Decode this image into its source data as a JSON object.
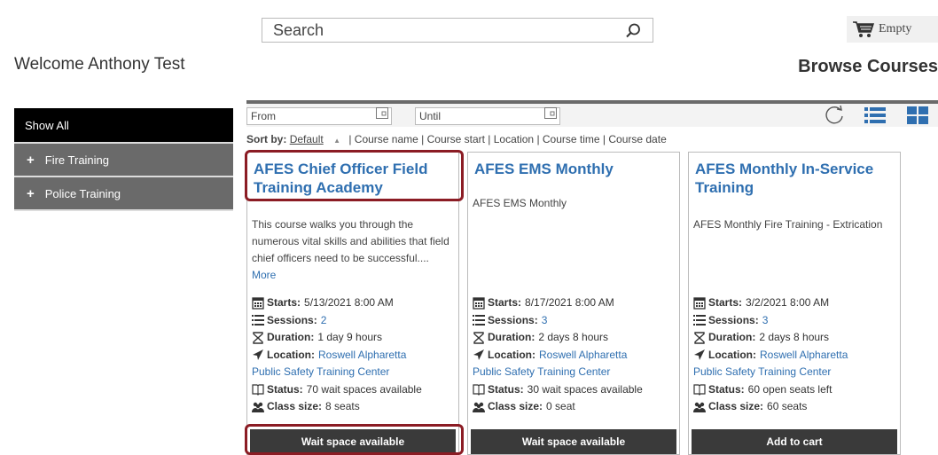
{
  "header": {
    "search_placeholder": "Search",
    "cart_label": "Empty",
    "welcome": "Welcome Anthony Test",
    "page_title": "Browse Courses"
  },
  "sidebar": {
    "items": [
      {
        "label": "Show All",
        "active": true
      },
      {
        "label": "Fire Training",
        "prefix": "+"
      },
      {
        "label": "Police Training",
        "prefix": "+"
      }
    ]
  },
  "filters": {
    "from_placeholder": "From",
    "until_placeholder": "Until"
  },
  "sort": {
    "label": "Sort by:",
    "default": "Default",
    "arrow": "▲",
    "options_text": "| Course name | Course start | Location | Course time | Course date"
  },
  "labels": {
    "starts": "Starts:",
    "sessions": "Sessions:",
    "duration": "Duration:",
    "location": "Location:",
    "status": "Status:",
    "class_size": "Class size:"
  },
  "courses": [
    {
      "title": "AFES Chief Officer Field Training Academy",
      "description": "This course walks you through the numerous vital skills and abilities that field chief officers need to be successful....",
      "more": "More",
      "starts": "5/13/2021 8:00 AM",
      "sessions": "2",
      "duration": "1 day 9 hours",
      "location_line1": "Roswell Alpharetta",
      "location_line2": "Public Safety Training Center",
      "status": "70 wait spaces available",
      "class_size": "8 seats",
      "button": "Wait space available"
    },
    {
      "title": "AFES EMS Monthly",
      "description": "AFES EMS Monthly",
      "starts": "8/17/2021 8:00 AM",
      "sessions": "3",
      "duration": "2 days 8 hours",
      "location_line1": "Roswell Alpharetta",
      "location_line2": "Public Safety Training Center",
      "status": "30 wait spaces available",
      "class_size": "0 seat",
      "button": "Wait space available"
    },
    {
      "title": "AFES Monthly In-Service Training",
      "description": "AFES Monthly Fire Training - Extrication",
      "starts": "3/2/2021 8:00 AM",
      "sessions": "3",
      "duration": "2 days 8 hours",
      "location_line1": "Roswell Alpharetta",
      "location_line2": "Public Safety Training Center",
      "status": "60 open seats left",
      "class_size": "60 seats",
      "button": "Add to cart"
    }
  ],
  "colors": {
    "link": "#2f6fb0",
    "highlight": "#8b1c24",
    "button_bg": "#3a3a3a",
    "sidebar_active": "#000000",
    "sidebar_item": "#6a6a6a"
  }
}
